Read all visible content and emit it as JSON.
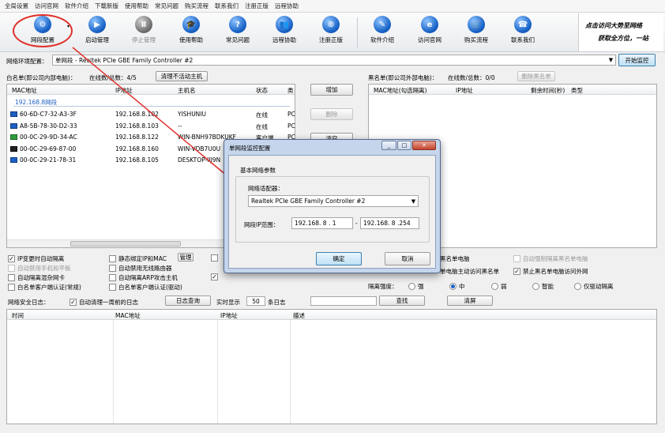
{
  "menu": [
    "全局设置",
    "访问官网",
    "软件介绍",
    "下载新版",
    "使用帮助",
    "常见问题",
    "购买流程",
    "联系我们",
    "注册正版",
    "远程协助"
  ],
  "toolbar": {
    "items": [
      {
        "label": "网段配置",
        "icon": "gear-icon",
        "glyph": "⚙"
      },
      {
        "label": "启动管理",
        "icon": "play-icon",
        "glyph": "▶"
      },
      {
        "label": "停止管理",
        "icon": "pause-icon",
        "glyph": "Ⅱ"
      },
      {
        "label": "使用帮助",
        "icon": "graduation-cap-icon",
        "glyph": "🎓"
      },
      {
        "label": "常见问题",
        "icon": "question-icon",
        "glyph": "?"
      },
      {
        "label": "远程协助",
        "icon": "remote-assist-icon",
        "glyph": "👥"
      },
      {
        "label": "注册正版",
        "icon": "registered-icon",
        "glyph": "®"
      },
      {
        "label": "软件介绍",
        "icon": "edit-icon",
        "glyph": "✎"
      },
      {
        "label": "访问官网",
        "icon": "globe-icon",
        "glyph": "e"
      },
      {
        "label": "购买流程",
        "icon": "cart-icon",
        "glyph": "🛒"
      },
      {
        "label": "联系我们",
        "icon": "phone-icon",
        "glyph": "☎"
      }
    ]
  },
  "ad": {
    "line1": "点击访问大势至网络",
    "line2": "获取全方位，一站"
  },
  "env": {
    "label": "网络环境配置：",
    "value": "单网段 - Realtek PCIe GBE Family Controller #2",
    "start_button": "开始监控"
  },
  "whitelist": {
    "title": "白名单(即公司内部电脑)：",
    "count": "在线数/总数：4/5",
    "clear_button": "清理不活动主机",
    "columns": [
      "MAC地址",
      "IP地址",
      "主机名",
      "状态",
      "类"
    ],
    "group": "192.168.8网段",
    "rows": [
      {
        "mac": "60-6D-C7-32-A3-3F",
        "ip": "192.168.8.102",
        "host": "YISHUNIU",
        "status": "在线",
        "type": "PC"
      },
      {
        "mac": "A8-5B-78-30-D2-33",
        "ip": "192.168.8.103",
        "host": "--",
        "status": "在线",
        "type": "PC"
      },
      {
        "mac": "00-0C-29-9D-34-AC",
        "ip": "192.168.8.122",
        "host": "WIN-BNH97BDKUKF",
        "status": "客户端",
        "type": "PC"
      },
      {
        "mac": "00-0C-29-69-87-00",
        "ip": "192.168.8.160",
        "host": "WIN-VDB7U0U",
        "status": "",
        "type": ""
      },
      {
        "mac": "00-0C-29-21-78-31",
        "ip": "192.168.8.105",
        "host": "DESKTOP-IIJ9N",
        "status": "",
        "type": ""
      }
    ]
  },
  "mid_buttons": {
    "add": "增加",
    "delete": "删除",
    "clear": "清空"
  },
  "blacklist": {
    "title": "黑名单(即公司外部电脑)：",
    "count": "在线数/总数：0/0",
    "delete_button": "删除黑名单",
    "columns": [
      "MAC地址(勾选隔离)",
      "IP地址",
      "剩余时间(秒)",
      "类型"
    ]
  },
  "options": {
    "ip_change_isolate": "IP变更时自动隔离",
    "static_bind": "静态绑定IP和MAC",
    "manage": "管理",
    "auto_disable_mobile": "自动禁用手机和平板",
    "auto_disable_router": "自动禁用无线路由器",
    "auto_isolate_nic": "自动隔离混杂网卡",
    "auto_isolate_arp": "自动隔离ARP攻击主机",
    "whitelist_ignore_pc": "白名单客户端认证(常规)",
    "whitelist_ignore_driver": "白名单客户端认证(驱动)",
    "blacklist_partial": "黑名单电脑",
    "auto_isolate_black": "自动强制隔离黑名单电脑",
    "blacklist_visit": "单电脑主动访问黑名单",
    "forbid_black_internet": "禁止黑名单电脑访问外网"
  },
  "strength": {
    "label": "隔离强度：",
    "options": [
      "强",
      "中",
      "弱",
      "智能",
      "仅驱动隔离"
    ],
    "selected": "中"
  },
  "log": {
    "label": "网络安全日志：",
    "auto_clear": "自动清理一周前的日志",
    "query_button": "日志查询",
    "realtime_label": "实时显示",
    "realtime_value": "50",
    "realtime_unit": "条日志",
    "find_button": "查找",
    "clear_button": "清屏",
    "columns": [
      "时间",
      "MAC地址",
      "IP地址",
      "描述"
    ]
  },
  "dialog": {
    "title": "单网段监控配置",
    "group": "基本网络参数",
    "adapter_label": "网络适配器：",
    "adapter_value": "Realtek PCIe GBE Family Controller #2",
    "range_label": "网段IP范围：",
    "ip_start": "192.168. 8 . 1",
    "ip_end": "192.168. 8 .254",
    "ok": "确定",
    "cancel": "取消"
  },
  "colors": {
    "accent": "#1863c7",
    "highlight": "#e0302a"
  }
}
